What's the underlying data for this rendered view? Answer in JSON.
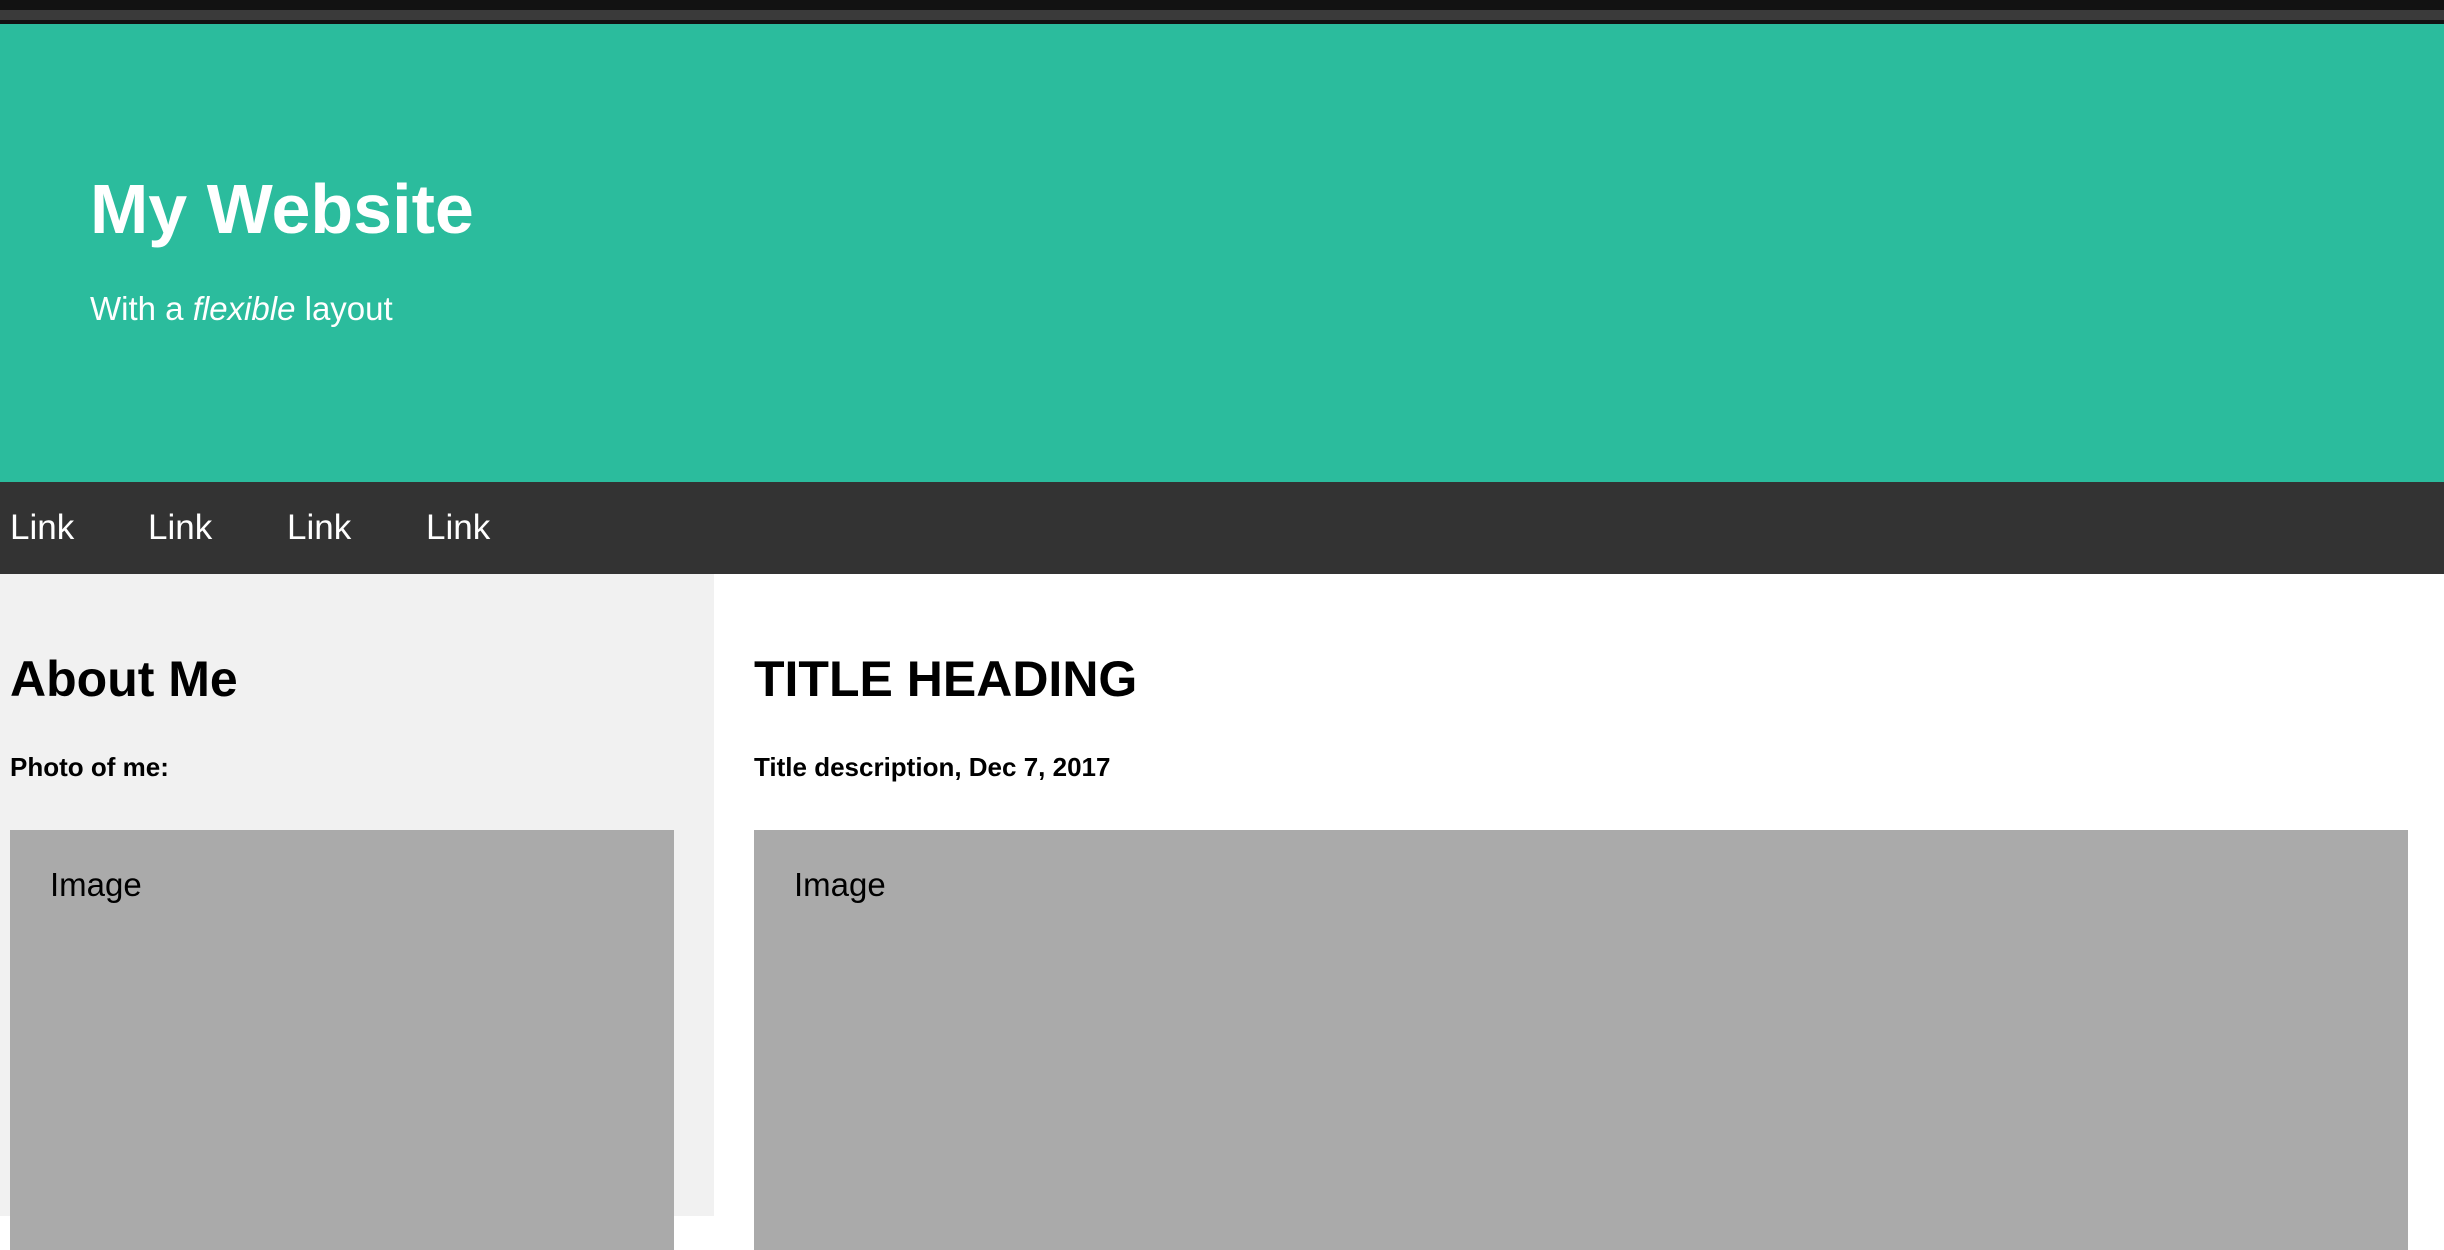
{
  "hero": {
    "title": "My Website",
    "subtitle_before": "With a ",
    "subtitle_emphasis": "flexible",
    "subtitle_after": " layout"
  },
  "nav": {
    "links": [
      "Link",
      "Link",
      "Link",
      "Link"
    ]
  },
  "side": {
    "heading": "About Me",
    "photo_label": "Photo of me:",
    "image_placeholder": "Image"
  },
  "main": {
    "heading": "TITLE HEADING",
    "description": "Title description, Dec 7, 2017",
    "image_placeholder": "Image"
  },
  "colors": {
    "hero_background": "#2bbc9d",
    "navbar_background": "#333333",
    "side_background": "#f1f1f1",
    "image_placeholder": "#aaaaaa"
  }
}
